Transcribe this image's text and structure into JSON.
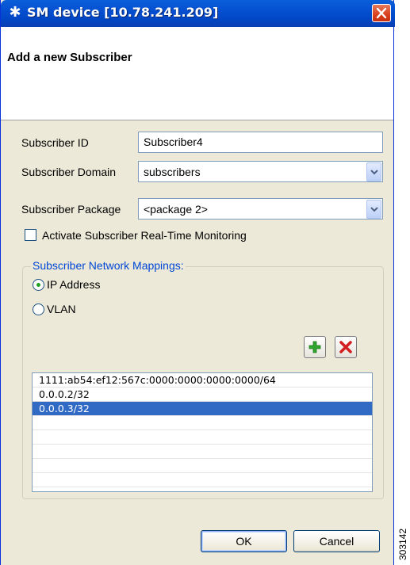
{
  "window": {
    "title": "SM device [10.78.241.209]",
    "app_icon": "cisco-network-icon",
    "close_icon": "close-icon"
  },
  "header": {
    "title": "Add a new Subscriber"
  },
  "form": {
    "subscriber_id_label": "Subscriber ID",
    "subscriber_id_value": "Subscriber4",
    "domain_label": "Subscriber Domain",
    "domain_value": "subscribers",
    "package_label": "Subscriber Package",
    "package_value": "<package 2>",
    "monitoring_label": "Activate Subscriber Real-Time Monitoring",
    "monitoring_checked": false
  },
  "mappings": {
    "legend": "Subscriber Network Mappings:",
    "radio_ip_label": "IP Address",
    "radio_vlan_label": "VLAN",
    "selected": "IP Address",
    "add_icon": "plus-icon",
    "remove_icon": "delete-x-icon",
    "items": [
      "1111:ab54:ef12:567c:0000:0000:0000:0000/64",
      "0.0.0.2/32",
      "0.0.0.3/32"
    ],
    "selected_item": "0.0.0.3/32"
  },
  "buttons": {
    "ok": "OK",
    "cancel": "Cancel"
  },
  "figure_number": "303142",
  "colors": {
    "title_bar": "#0054e3",
    "selection": "#316ac5",
    "group_legend": "#0046d5",
    "radio_dot": "#21a121",
    "add_green": "#2fa52f",
    "remove_red": "#d21f1f"
  }
}
